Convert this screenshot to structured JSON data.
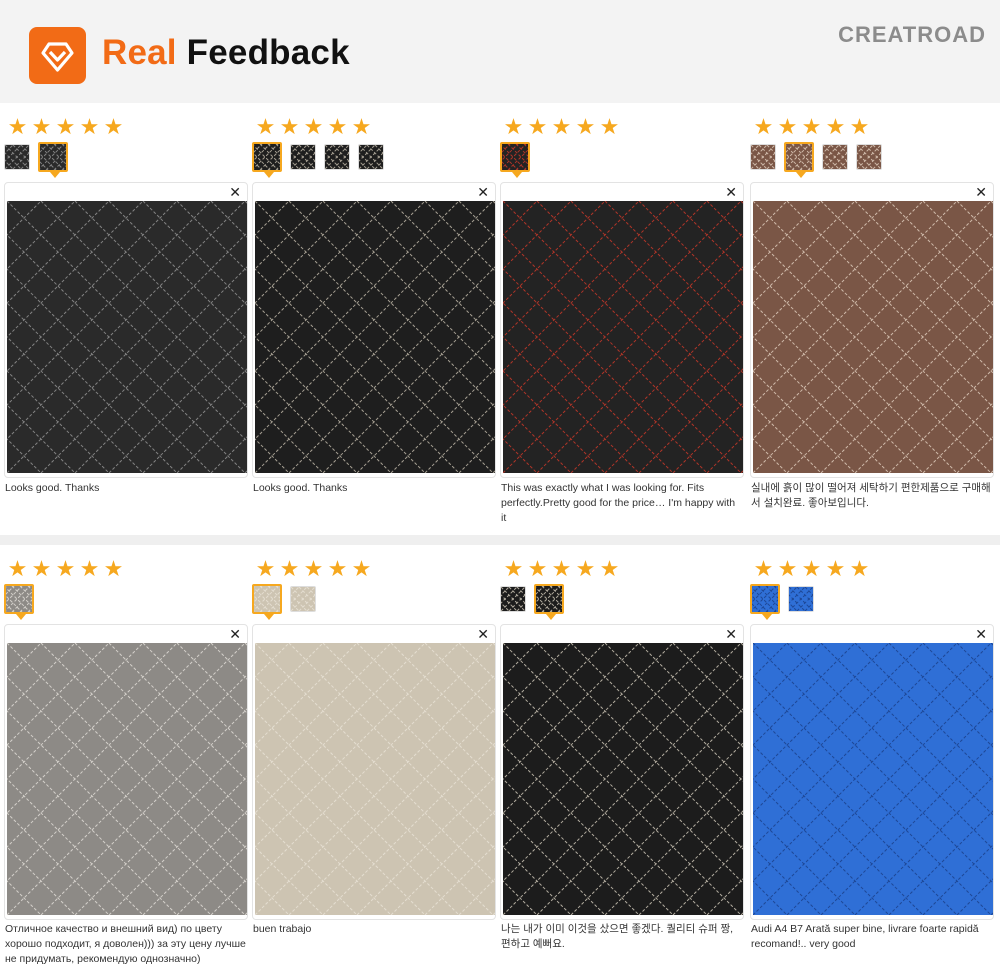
{
  "header": {
    "title_word1": "Real",
    "title_word2": "Feedback",
    "brand": "CREATROAD",
    "accent_color": "#f26b16"
  },
  "star_color": "#f6a81f",
  "reviews": [
    {
      "rating": 5,
      "thumb_count": 2,
      "selected_thumb": 2,
      "text": "Looks good. Thanks",
      "mat_color": "#2a2a2a",
      "stitch_color": "#9a9a9a"
    },
    {
      "rating": 5,
      "thumb_count": 4,
      "selected_thumb": 1,
      "text": "Looks good. Thanks",
      "mat_color": "#1e1e1e",
      "stitch_color": "#c8c0b0"
    },
    {
      "rating": 5,
      "thumb_count": 1,
      "selected_thumb": 1,
      "text": "This was exactly what I was looking for. Fits perfectly.Pretty good for the price… I'm happy with it",
      "mat_color": "#232323",
      "stitch_color": "#d23a2a"
    },
    {
      "rating": 5,
      "thumb_count": 4,
      "selected_thumb": 2,
      "text": "실내에 흙이 많이 떨어져 세탁하기 편한제품으로 구매해서 설치완료. 좋아보입니다.",
      "mat_color": "#7a5646",
      "stitch_color": "#e5d3c3"
    },
    {
      "rating": 5,
      "thumb_count": 1,
      "selected_thumb": 1,
      "text": "Отличное качество и внешний вид) по цвету хорошо подходит, я доволен))) за эту цену лучше не придумать, рекомендую однозначно)",
      "mat_color": "#8d8a86",
      "stitch_color": "#e6e2dc"
    },
    {
      "rating": 5,
      "thumb_count": 2,
      "selected_thumb": 1,
      "text": "buen trabajo",
      "mat_color": "#cdc4b2",
      "stitch_color": "#eae4d8"
    },
    {
      "rating": 5,
      "thumb_count": 2,
      "selected_thumb": 2,
      "text": "나는 내가 이미 이것을 샀으면 좋겠다. 퀄리티 슈퍼 짱, 편하고 예뻐요.",
      "mat_color": "#1c1c1c",
      "stitch_color": "#d8d0c0"
    },
    {
      "rating": 5,
      "thumb_count": 2,
      "selected_thumb": 1,
      "text": "Audi A4 B7 Arată super bine, livrare foarte rapidă recomand!.. very good",
      "mat_color": "#2f6fd6",
      "stitch_color": "#1a3e86"
    }
  ]
}
